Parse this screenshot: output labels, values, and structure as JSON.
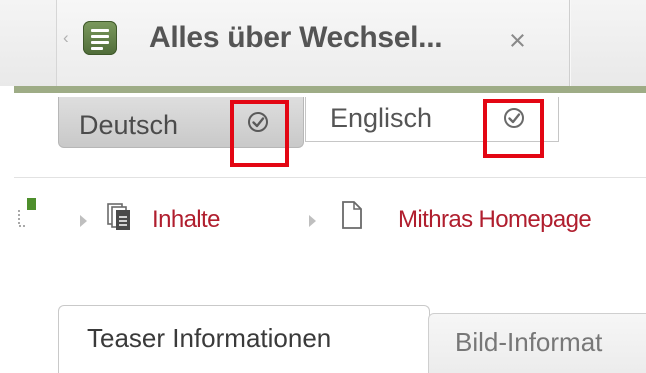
{
  "document_tab": {
    "title": "Alles über Wechsel...",
    "close_glyph": "×",
    "scroll_glyph": "‹",
    "icon": "document-list-icon"
  },
  "language_tabs": [
    {
      "label": "Deutsch",
      "status_icon": "check-circle-icon",
      "active": true
    },
    {
      "label": "Englisch",
      "status_icon": "check-circle-icon",
      "active": false
    }
  ],
  "breadcrumb": {
    "items": [
      {
        "label": "Inhalte",
        "icon": "folder-pages-icon"
      },
      {
        "label": "Mithras Homepage",
        "icon": "page-icon"
      }
    ]
  },
  "content_tabs": [
    {
      "label": "Teaser Informationen",
      "active": true
    },
    {
      "label": "Bild-Informat",
      "active": false
    }
  ],
  "colors": {
    "accent_green": "#9eac86",
    "link_red": "#b01e2e",
    "highlight_red": "#e30613"
  }
}
